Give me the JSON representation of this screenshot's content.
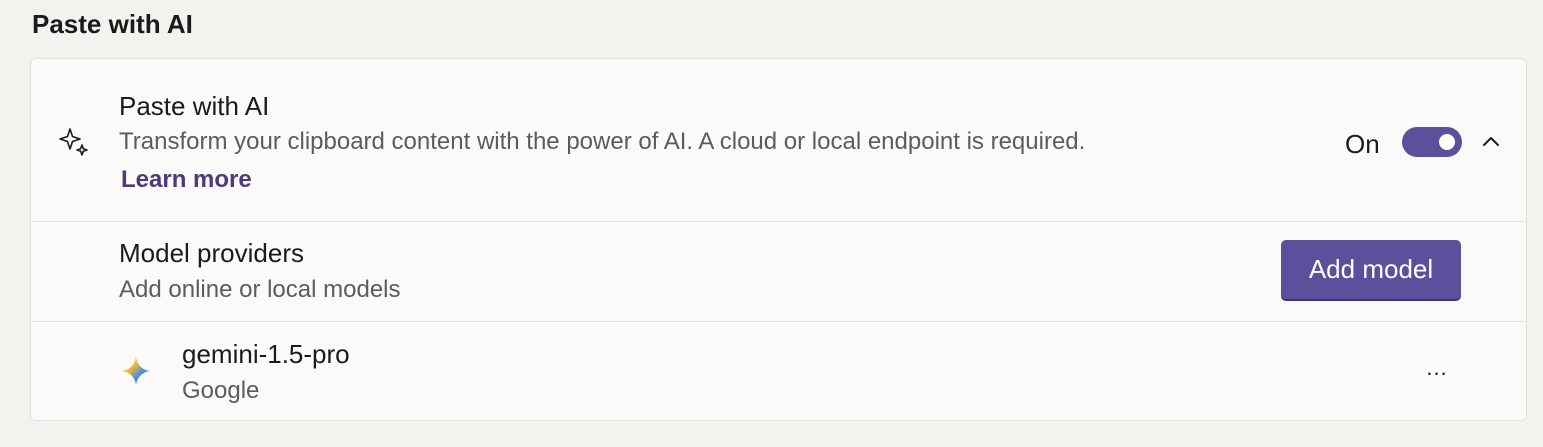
{
  "section": {
    "title": "Paste with AI"
  },
  "main_setting": {
    "icon": "sparkle-icon",
    "title": "Paste with AI",
    "description": "Transform your clipboard content with the power of AI. A cloud or local endpoint is required.",
    "link_label": "Learn more",
    "toggle_state_label": "On",
    "toggle_on": true,
    "accent_color": "#5e4f9c",
    "expand_icon": "chevron-up-icon"
  },
  "providers": {
    "title": "Model providers",
    "description": "Add online or local models",
    "add_button_label": "Add model"
  },
  "models": [
    {
      "icon": "gemini-icon",
      "name": "gemini-1.5-pro",
      "provider": "Google",
      "more_label": "..."
    }
  ]
}
